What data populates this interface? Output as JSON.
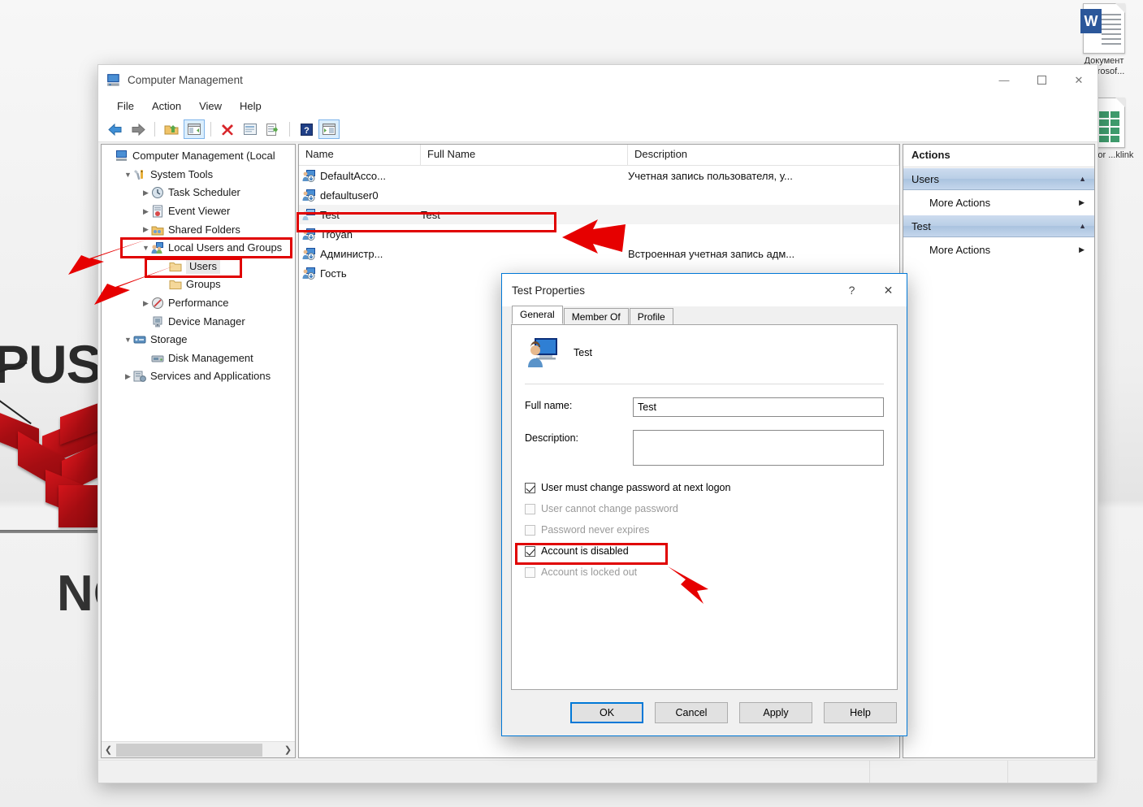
{
  "desktop": {
    "wallpaper": {
      "text_top": "PUSI",
      "text_bottom": "NO",
      "logo_color": "#c1121a"
    },
    "icons": [
      {
        "name": "word-document",
        "label": "Документ Microsof...",
        "type": "word"
      },
      {
        "name": "excel-document",
        "label": "sites for ...klink",
        "type": "excel"
      }
    ]
  },
  "window": {
    "title": "Computer Management",
    "icon": "computer-management-icon",
    "controls": {
      "minimize": "—",
      "maximize": "▢",
      "close": "✕"
    },
    "menu": [
      "File",
      "Action",
      "View",
      "Help"
    ],
    "toolbar_icons": [
      "back-arrow-icon",
      "forward-arrow-icon",
      "separator",
      "up-folder-icon",
      "show-hide-console-tree-icon",
      "separator",
      "delete-icon",
      "properties-icon",
      "export-list-icon",
      "separator",
      "help-icon",
      "show-hide-action-pane-icon"
    ],
    "status_segments": [
      "",
      "",
      ""
    ]
  },
  "tree": {
    "nodes": [
      {
        "label": "Computer Management (Local",
        "depth": 0,
        "twisty": "",
        "icon": "computer-management-icon"
      },
      {
        "label": "System Tools",
        "depth": 1,
        "twisty": "v",
        "icon": "system-tools-icon"
      },
      {
        "label": "Task Scheduler",
        "depth": 2,
        "twisty": ">",
        "icon": "clock-icon"
      },
      {
        "label": "Event Viewer",
        "depth": 2,
        "twisty": ">",
        "icon": "event-viewer-icon"
      },
      {
        "label": "Shared Folders",
        "depth": 2,
        "twisty": ">",
        "icon": "shared-folders-icon"
      },
      {
        "label": "Local Users and Groups",
        "depth": 2,
        "twisty": "v",
        "icon": "local-users-groups-icon"
      },
      {
        "label": "Users",
        "depth": 3,
        "twisty": "",
        "icon": "folder-icon",
        "selected": true
      },
      {
        "label": "Groups",
        "depth": 3,
        "twisty": "",
        "icon": "folder-icon"
      },
      {
        "label": "Performance",
        "depth": 2,
        "twisty": ">",
        "icon": "performance-icon"
      },
      {
        "label": "Device Manager",
        "depth": 2,
        "twisty": "",
        "icon": "device-manager-icon"
      },
      {
        "label": "Storage",
        "depth": 1,
        "twisty": "v",
        "icon": "storage-icon"
      },
      {
        "label": "Disk Management",
        "depth": 2,
        "twisty": "",
        "icon": "disk-management-icon"
      },
      {
        "label": "Services and Applications",
        "depth": 1,
        "twisty": ">",
        "icon": "services-icon"
      }
    ]
  },
  "list": {
    "columns": [
      "Name",
      "Full Name",
      "Description"
    ],
    "rows": [
      {
        "name": "DefaultAcco...",
        "full_name": "",
        "description": "Учетная запись пользователя, у..."
      },
      {
        "name": "defaultuser0",
        "full_name": "",
        "description": ""
      },
      {
        "name": "Test",
        "full_name": "Test",
        "description": "",
        "selected": true
      },
      {
        "name": "Troyan",
        "full_name": "",
        "description": ""
      },
      {
        "name": "Администр...",
        "full_name": "",
        "description": "Встроенная учетная запись адм..."
      },
      {
        "name": "Гость",
        "full_name": "",
        "description": ""
      }
    ]
  },
  "actions": {
    "title": "Actions",
    "groups": [
      {
        "header": "Users",
        "items": [
          {
            "label": "More Actions"
          }
        ]
      },
      {
        "header": "Test",
        "items": [
          {
            "label": "More Actions"
          }
        ]
      }
    ]
  },
  "dialog": {
    "title": "Test Properties",
    "help_button": "?",
    "close_button": "✕",
    "tabs": [
      {
        "label": "General",
        "active": true
      },
      {
        "label": "Member Of",
        "active": false
      },
      {
        "label": "Profile",
        "active": false
      }
    ],
    "user_name": "Test",
    "fields": [
      {
        "label": "Full name:",
        "value": "Test",
        "placeholder": "",
        "tall": false
      },
      {
        "label": "Description:",
        "value": "",
        "placeholder": "",
        "tall": true
      }
    ],
    "checkboxes": [
      {
        "label": "User must change password at next logon",
        "checked": true,
        "disabled": false
      },
      {
        "label": "User cannot change password",
        "checked": false,
        "disabled": true
      },
      {
        "label": "Password never expires",
        "checked": false,
        "disabled": true
      },
      {
        "label": "Account is disabled",
        "checked": true,
        "disabled": false,
        "highlighted": true
      },
      {
        "label": "Account is locked out",
        "checked": false,
        "disabled": true
      }
    ],
    "buttons": [
      {
        "label": "OK",
        "default": true
      },
      {
        "label": "Cancel",
        "default": false
      },
      {
        "label": "Apply",
        "default": false
      },
      {
        "label": "Help",
        "default": false
      }
    ]
  },
  "annotations": {
    "highlight_color": "#e00000",
    "boxes": [
      {
        "name": "highlight-local-users-and-groups"
      },
      {
        "name": "highlight-users-node"
      },
      {
        "name": "highlight-test-row"
      },
      {
        "name": "highlight-account-is-disabled"
      }
    ],
    "arrows": [
      {
        "name": "arrow-to-local-users-and-groups"
      },
      {
        "name": "arrow-to-users-node"
      },
      {
        "name": "arrow-to-test-row"
      },
      {
        "name": "arrow-to-account-is-disabled"
      }
    ]
  }
}
